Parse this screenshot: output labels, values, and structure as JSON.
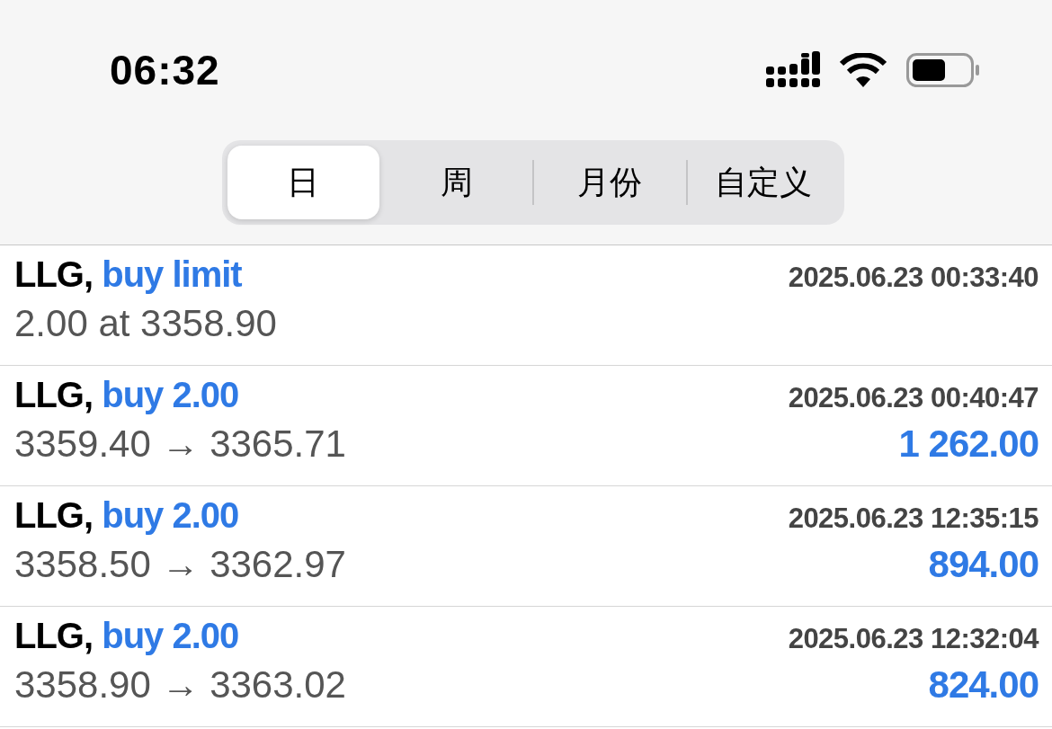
{
  "status_bar": {
    "time": "06:32"
  },
  "segments": [
    {
      "label": "日",
      "selected": true
    },
    {
      "label": "周",
      "selected": false
    },
    {
      "label": "月份",
      "selected": false
    },
    {
      "label": "自定义",
      "selected": false
    }
  ],
  "orders": [
    {
      "symbol": "LLG,",
      "action": "buy limit",
      "time": "2025.06.23 00:33:40",
      "details": "2.00 at 3358.90"
    },
    {
      "symbol": "LLG,",
      "action": "buy 2.00",
      "time": "2025.06.23 00:40:47",
      "details": "3359.40 → 3365.71",
      "profit": "1 262.00"
    },
    {
      "symbol": "LLG,",
      "action": "buy 2.00",
      "time": "2025.06.23 12:35:15",
      "details": "3358.50 → 3362.97",
      "profit": "894.00"
    },
    {
      "symbol": "LLG,",
      "action": "buy 2.00",
      "time": "2025.06.23 12:32:04",
      "details": "3358.90 → 3363.02",
      "profit": "824.00"
    }
  ]
}
